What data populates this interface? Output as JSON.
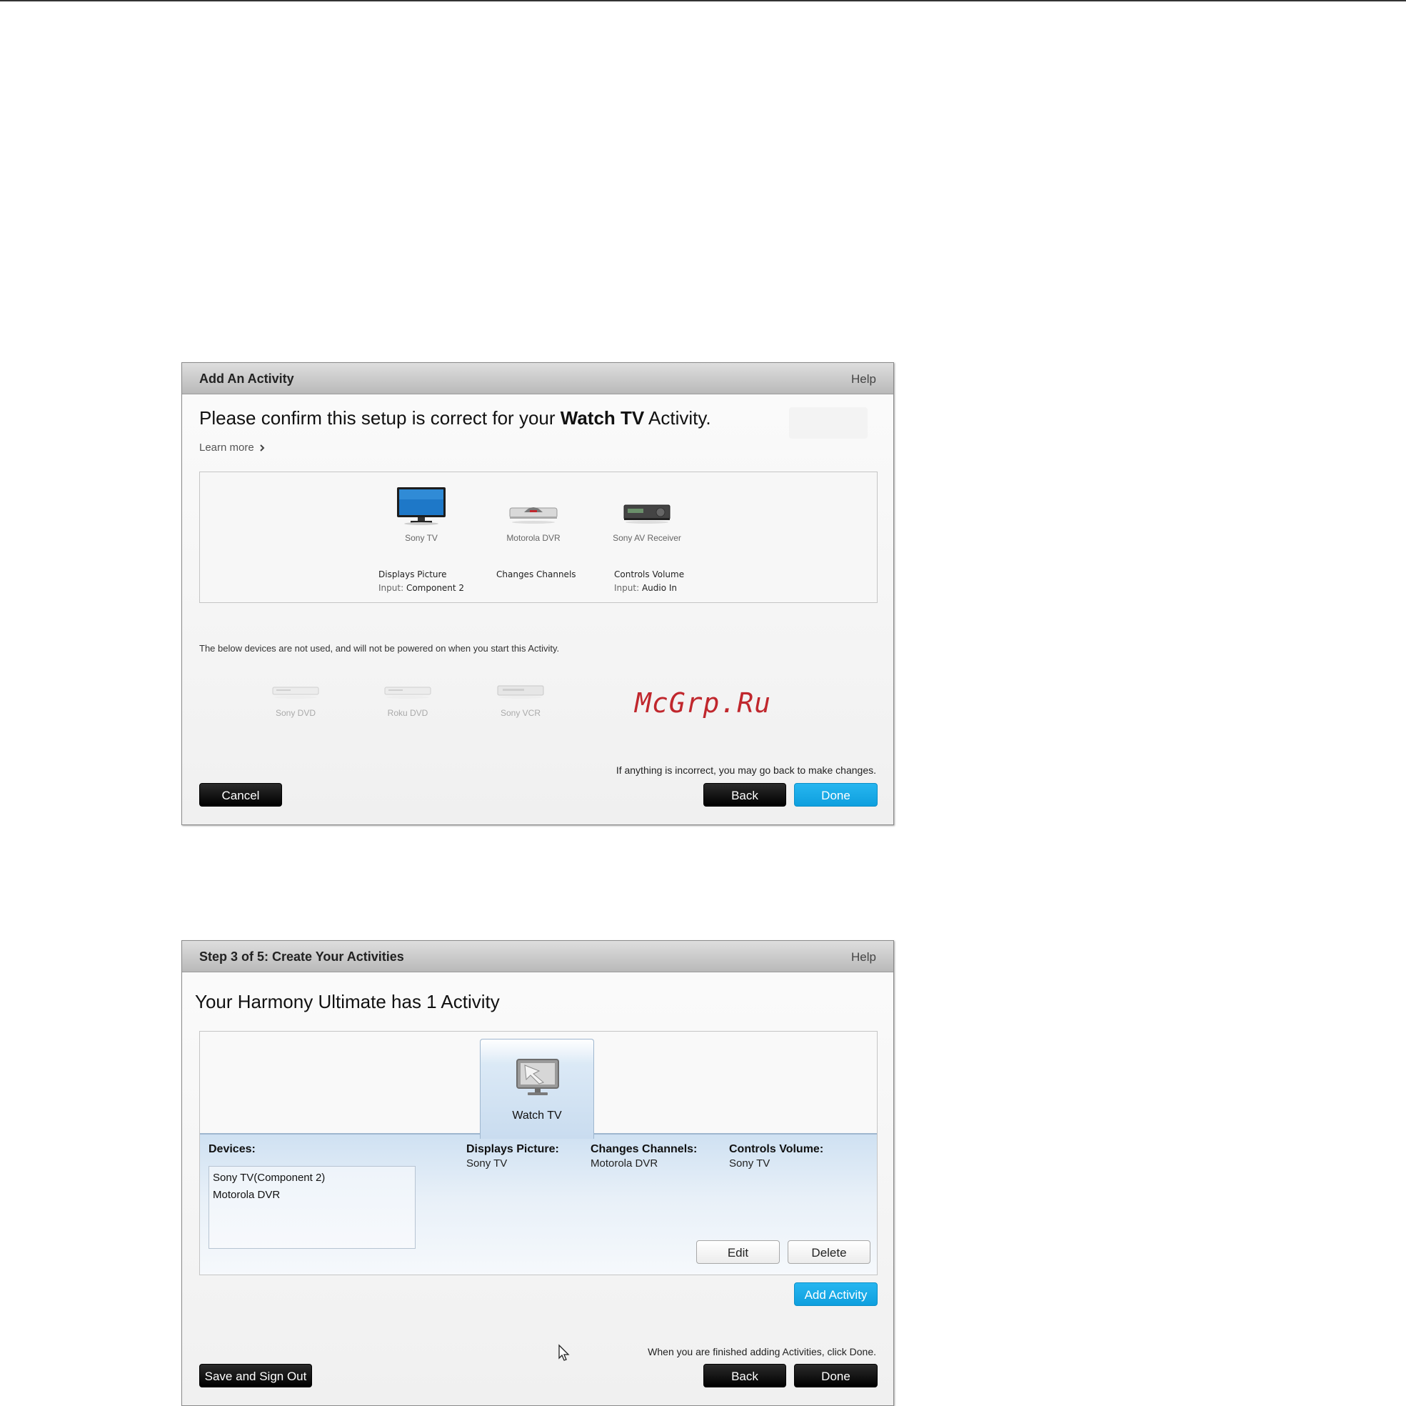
{
  "add_activity_panel": {
    "title": "Add An Activity",
    "help": "Help",
    "heading_pre": "Please confirm this setup is correct for your ",
    "heading_activity": "Watch TV",
    "heading_post": " Activity.",
    "learn_more": "Learn more",
    "learn_more_icon": "chevron-right-icon",
    "used_devices": [
      {
        "name": "Sony TV",
        "icon": "tv-icon",
        "role": "Displays Picture",
        "input_label": "Input:",
        "input_value": "Component 2"
      },
      {
        "name": "Motorola DVR",
        "icon": "dvr-icon",
        "role": "Changes Channels",
        "input_label": "",
        "input_value": ""
      },
      {
        "name": "Sony AV Receiver",
        "icon": "av-receiver-icon",
        "role": "Controls Volume",
        "input_label": "Input:",
        "input_value": "Audio In"
      }
    ],
    "unused_note": "The below devices are not used, and will not be powered on when you start this Activity.",
    "unused_devices": [
      {
        "name": "Sony DVD",
        "icon": "dvd-player-icon"
      },
      {
        "name": "Roku DVD",
        "icon": "dvd-player-icon"
      },
      {
        "name": "Sony VCR",
        "icon": "vcr-icon"
      }
    ],
    "incorrect_note": "If anything is incorrect, you may go back to make changes.",
    "cancel": "Cancel",
    "back": "Back",
    "done": "Done"
  },
  "watermark": "McGrp.Ru",
  "create_activities_panel": {
    "title": "Step 3 of 5: Create Your Activities",
    "help": "Help",
    "heading": "Your Harmony Ultimate has 1 Activity",
    "activity_tab": {
      "label": "Watch TV",
      "icon": "watch-tv-icon"
    },
    "devices_label": "Devices:",
    "devices": [
      "Sony TV(Component 2)",
      "Motorola DVR"
    ],
    "displays_picture_label": "Displays Picture:",
    "displays_picture_value": "Sony TV",
    "changes_channels_label": "Changes Channels:",
    "changes_channels_value": "Motorola DVR",
    "controls_volume_label": "Controls Volume:",
    "controls_volume_value": "Sony TV",
    "edit": "Edit",
    "delete": "Delete",
    "add_activity": "Add Activity",
    "finished_note": "When you are finished adding Activities, click Done.",
    "save_sign_out": "Save and Sign Out",
    "back": "Back",
    "done": "Done"
  },
  "colors": {
    "accent_blue": "#12a8e6",
    "button_black": "#111111",
    "watermark_red": "#c0272d",
    "header_gray": "#c8c8c8"
  }
}
